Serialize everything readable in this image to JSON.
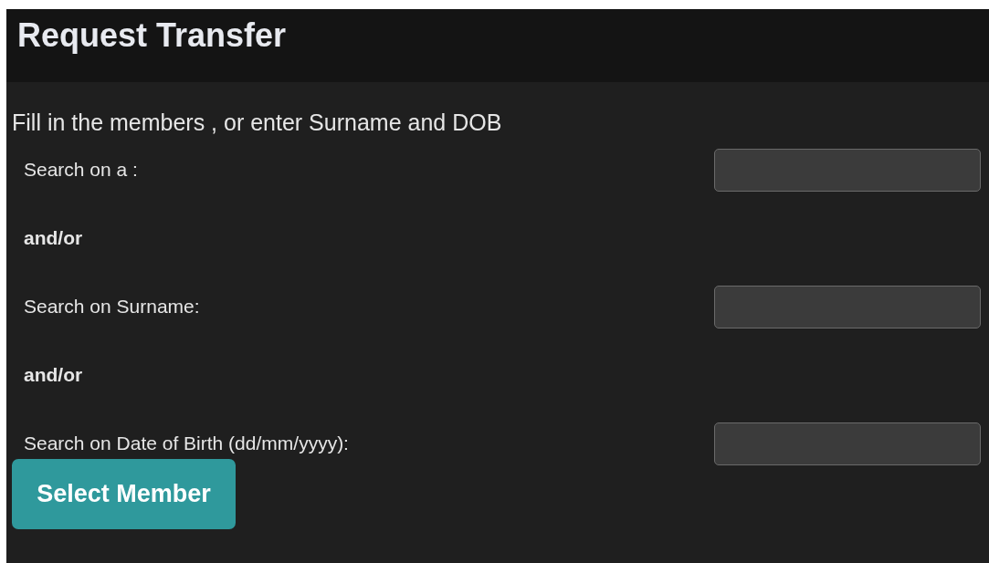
{
  "header": {
    "title": "Request Transfer"
  },
  "intro": "Fill in the members , or enter Surname and DOB",
  "rows": [
    {
      "kind": "field",
      "label": "Search on a :"
    },
    {
      "kind": "separator",
      "label": "and/or"
    },
    {
      "kind": "field",
      "label": "Search on Surname:"
    },
    {
      "kind": "separator",
      "label": "and/or"
    },
    {
      "kind": "field",
      "label": "Search on Date of Birth (dd/mm/yyyy):"
    }
  ],
  "button": "Select Member"
}
